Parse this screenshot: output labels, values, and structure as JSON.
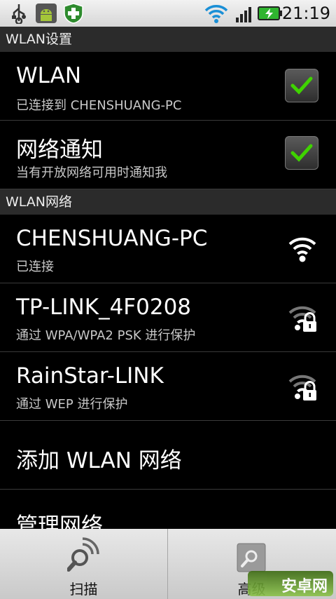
{
  "status_bar": {
    "time": "21:19",
    "icons": [
      "usb-icon",
      "android-debug-icon",
      "security-shield-icon",
      "wifi-signal-icon",
      "cell-signal-icon",
      "battery-charging-icon"
    ]
  },
  "header": {
    "title": "WLAN设置"
  },
  "settings": [
    {
      "title": "WLAN",
      "subtitle": "已连接到 CHENSHUANG-PC",
      "checked": true
    },
    {
      "title": "网络通知",
      "subtitle": "当有开放网络可用时通知我",
      "checked": true
    }
  ],
  "networks_header": {
    "title": "WLAN网络"
  },
  "networks": [
    {
      "name": "CHENSHUANG-PC",
      "status": "已连接",
      "secured": false
    },
    {
      "name": "TP-LINK_4F0208",
      "status": "通过 WPA/WPA2 PSK 进行保护",
      "secured": true
    },
    {
      "name": "RainStar-LINK",
      "status": "通过 WEP 进行保护",
      "secured": true
    }
  ],
  "actions": {
    "add_network": "添加 WLAN 网络",
    "manage_networks": "管理网络"
  },
  "bottom_bar": {
    "scan_label": "扫描",
    "advanced_label": "高级"
  },
  "watermark": {
    "text": "安卓网"
  },
  "colors": {
    "check": "#3fd300",
    "status_bar_bg": "#e6e6e6",
    "section_header_bg": "#2b2b2b"
  }
}
